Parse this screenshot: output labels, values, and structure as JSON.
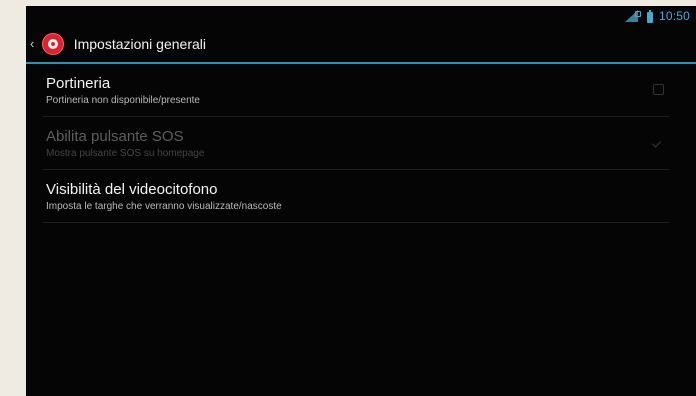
{
  "status_bar": {
    "time": "10:50",
    "icons": [
      "signal-icon",
      "battery-icon"
    ]
  },
  "action_bar": {
    "title": "Impostazioni generali",
    "icons": [
      "back-icon",
      "app-logo-icon"
    ]
  },
  "settings": [
    {
      "title": "Portineria",
      "subtitle": "Portineria non disponibile/presente",
      "control": "checkbox",
      "checked": false,
      "enabled": true
    },
    {
      "title": "Abilita pulsante SOS",
      "subtitle": "Mostra pulsante SOS su homepage",
      "control": "checkbox",
      "checked": true,
      "enabled": false
    },
    {
      "title": "Visibilità del videocitofono",
      "subtitle": "Imposta le targhe che verranno visualizzate/nascoste",
      "control": "none",
      "enabled": true
    }
  ],
  "colors": {
    "accent": "#2e92b4",
    "status": "#47a8d6",
    "background": "#050505",
    "frame": "#efebe3",
    "logo": "#d7262f"
  }
}
